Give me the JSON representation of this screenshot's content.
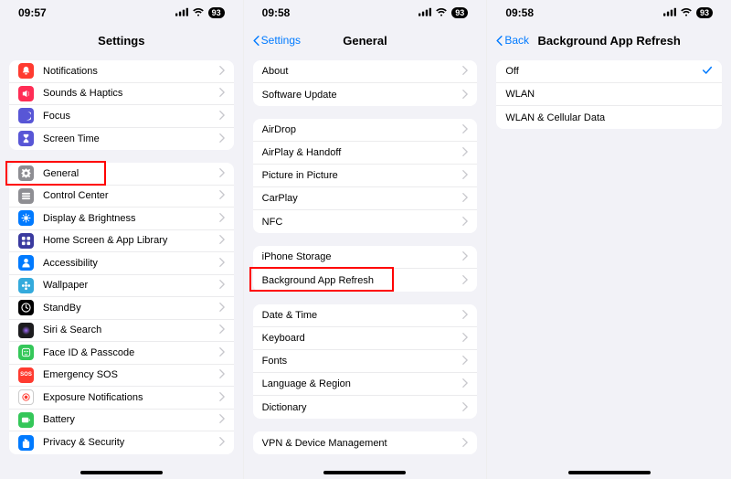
{
  "statusBar": {
    "battery": "93"
  },
  "screens": [
    {
      "time": "09:57",
      "title": "Settings",
      "back": null,
      "groups": [
        [
          {
            "label": "Notifications",
            "iconColor": "#ff3b30",
            "icon": "bell"
          },
          {
            "label": "Sounds & Haptics",
            "iconColor": "#ff2d55",
            "icon": "speaker"
          },
          {
            "label": "Focus",
            "iconColor": "#5856d6",
            "icon": "moon"
          },
          {
            "label": "Screen Time",
            "iconColor": "#5856d6",
            "icon": "hourglass"
          }
        ],
        [
          {
            "label": "General",
            "iconColor": "#8e8e93",
            "icon": "gear",
            "highlight": true
          },
          {
            "label": "Control Center",
            "iconColor": "#8e8e93",
            "icon": "sliders"
          },
          {
            "label": "Display & Brightness",
            "iconColor": "#007aff",
            "icon": "sun"
          },
          {
            "label": "Home Screen & App Library",
            "iconColor": "#3a3a9f",
            "icon": "grid"
          },
          {
            "label": "Accessibility",
            "iconColor": "#007aff",
            "icon": "person"
          },
          {
            "label": "Wallpaper",
            "iconColor": "#34aadc",
            "icon": "flower"
          },
          {
            "label": "StandBy",
            "iconColor": "#000000",
            "icon": "clock"
          },
          {
            "label": "Siri & Search",
            "iconColor": "#1c1c1e",
            "icon": "siri"
          },
          {
            "label": "Face ID & Passcode",
            "iconColor": "#34c759",
            "icon": "face"
          },
          {
            "label": "Emergency SOS",
            "iconColor": "#ff3b30",
            "icon": "sos",
            "textIcon": "SOS"
          },
          {
            "label": "Exposure Notifications",
            "iconColor": "#ffffff",
            "icon": "exposure",
            "iconBorder": true
          },
          {
            "label": "Battery",
            "iconColor": "#34c759",
            "icon": "battery"
          },
          {
            "label": "Privacy & Security",
            "iconColor": "#007aff",
            "icon": "hand"
          }
        ]
      ]
    },
    {
      "time": "09:58",
      "title": "General",
      "back": "Settings",
      "groups": [
        [
          {
            "label": "About"
          },
          {
            "label": "Software Update"
          }
        ],
        [
          {
            "label": "AirDrop"
          },
          {
            "label": "AirPlay & Handoff"
          },
          {
            "label": "Picture in Picture"
          },
          {
            "label": "CarPlay"
          },
          {
            "label": "NFC"
          }
        ],
        [
          {
            "label": "iPhone Storage"
          },
          {
            "label": "Background App Refresh",
            "highlight": true
          }
        ],
        [
          {
            "label": "Date & Time"
          },
          {
            "label": "Keyboard"
          },
          {
            "label": "Fonts"
          },
          {
            "label": "Language & Region"
          },
          {
            "label": "Dictionary"
          }
        ],
        [
          {
            "label": "VPN & Device Management"
          }
        ]
      ]
    },
    {
      "time": "09:58",
      "title": "Background App Refresh",
      "back": "Back",
      "groups": [
        [
          {
            "label": "Off",
            "selected": true,
            "noChevron": true
          },
          {
            "label": "WLAN",
            "noChevron": true
          },
          {
            "label": "WLAN & Cellular Data",
            "noChevron": true
          }
        ]
      ]
    }
  ]
}
